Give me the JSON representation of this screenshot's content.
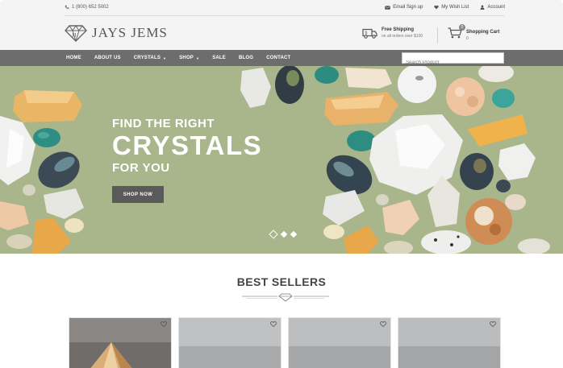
{
  "topbar": {
    "phone": "1 (800) 652 5002",
    "links": [
      {
        "icon": "envelope-icon",
        "label": "Email Sign up"
      },
      {
        "icon": "heart-icon",
        "label": "My Wish List"
      },
      {
        "icon": "user-icon",
        "label": "Account"
      }
    ]
  },
  "header": {
    "logo_text": "JAYS JEMS",
    "shipping_title": "Free Shipping",
    "shipping_sub": "on all orders over $100",
    "cart_title": "Shopping Cart",
    "cart_count": "0",
    "cart_badge": "0"
  },
  "nav": {
    "items": [
      {
        "label": "HOME",
        "dropdown": false
      },
      {
        "label": "ABOUT US",
        "dropdown": false
      },
      {
        "label": "CRYSTALS",
        "dropdown": true
      },
      {
        "label": "SHOP",
        "dropdown": true
      },
      {
        "label": "SALE",
        "dropdown": false
      },
      {
        "label": "BLOG",
        "dropdown": false
      },
      {
        "label": "CONTACT",
        "dropdown": false
      }
    ],
    "search_placeholder": "Search Product"
  },
  "hero": {
    "line1": "FIND THE RIGHT",
    "line2": "CRYSTALS",
    "line3": "FOR YOU",
    "button": "SHOP NOW",
    "slides": 3,
    "active_slide": 1,
    "bg_color": "#a9b58a"
  },
  "best_sellers": {
    "title": "BEST SELLERS",
    "product_count": 4
  },
  "colors": {
    "nav_bg": "#6d6d6d",
    "button_bg": "#5a5a5a",
    "header_bg": "#f4f4f4"
  }
}
